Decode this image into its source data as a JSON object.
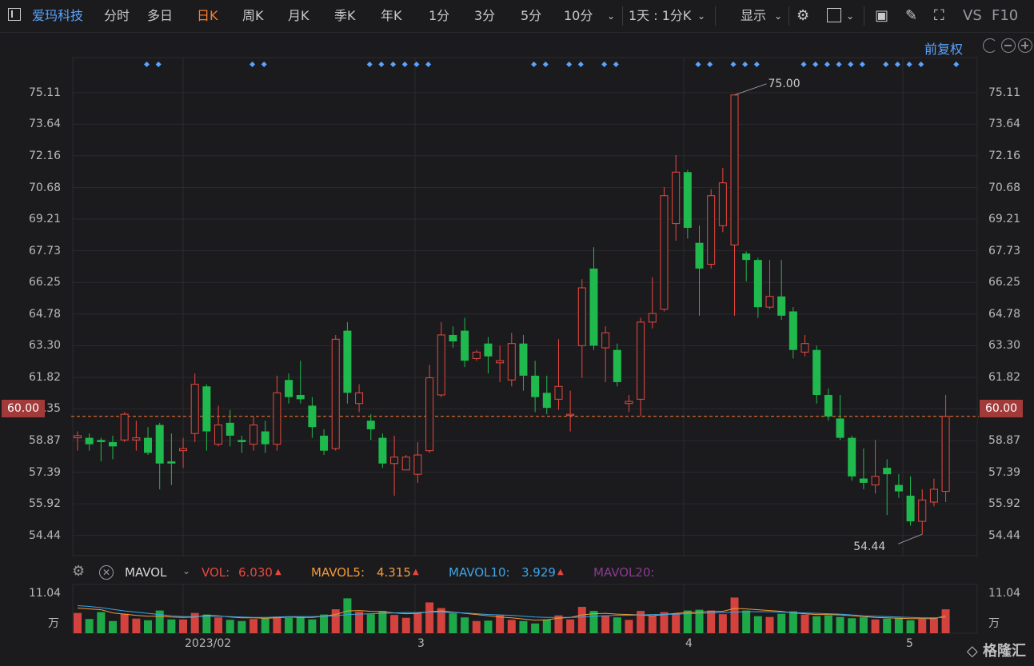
{
  "topbar": {
    "stock_name": "爱玛科技",
    "periods": [
      "分时",
      "多日",
      "日K",
      "周K",
      "月K",
      "季K",
      "年K",
      "1分",
      "3分",
      "5分",
      "10分"
    ],
    "active_period": "日K",
    "combo_label": "1天 : 1分K",
    "display_label": "显示",
    "right_labels": [
      "VS",
      "F10"
    ]
  },
  "sub": {
    "adjust_label": "前复权"
  },
  "colors": {
    "up": "#e8473f",
    "down": "#1fb94e",
    "accent": "#5aa3ff",
    "current": "#ff7a2a",
    "grid": "#2b2b30"
  },
  "chart_data": {
    "type": "candlestick",
    "y_ticks": [
      "75.11",
      "73.64",
      "72.16",
      "70.68",
      "69.21",
      "67.73",
      "66.25",
      "64.78",
      "63.30",
      "61.82",
      "60.35",
      "58.87",
      "57.39",
      "55.92",
      "54.44"
    ],
    "ylim": [
      53.5,
      76.0
    ],
    "current_price": "60.00",
    "current_value": 60.0,
    "annotations": {
      "high": "75.00",
      "low": "54.44"
    },
    "x_labels": [
      "2023/02",
      "3",
      "4",
      "5"
    ],
    "candles": [
      {
        "o": 59.0,
        "c": 59.1,
        "h": 59.3,
        "l": 58.4
      },
      {
        "o": 59.0,
        "c": 58.7,
        "h": 59.2,
        "l": 58.4
      },
      {
        "o": 58.9,
        "c": 58.8,
        "h": 59.0,
        "l": 57.9
      },
      {
        "o": 58.8,
        "c": 58.6,
        "h": 59.1,
        "l": 58.0
      },
      {
        "o": 58.9,
        "c": 60.1,
        "h": 60.2,
        "l": 58.8
      },
      {
        "o": 58.9,
        "c": 59.0,
        "h": 59.8,
        "l": 58.4
      },
      {
        "o": 59.0,
        "c": 58.3,
        "h": 59.5,
        "l": 58.2
      },
      {
        "o": 59.6,
        "c": 57.8,
        "h": 59.7,
        "l": 56.6
      },
      {
        "o": 57.9,
        "c": 57.8,
        "h": 59.2,
        "l": 56.8
      },
      {
        "o": 58.4,
        "c": 58.5,
        "h": 59.0,
        "l": 57.6
      },
      {
        "o": 59.2,
        "c": 61.5,
        "h": 62.0,
        "l": 58.8
      },
      {
        "o": 61.4,
        "c": 59.3,
        "h": 61.5,
        "l": 58.4
      },
      {
        "o": 58.7,
        "c": 59.6,
        "h": 60.5,
        "l": 58.6
      },
      {
        "o": 59.7,
        "c": 59.1,
        "h": 60.3,
        "l": 58.6
      },
      {
        "o": 58.9,
        "c": 58.8,
        "h": 59.1,
        "l": 58.3
      },
      {
        "o": 58.7,
        "c": 59.6,
        "h": 60.0,
        "l": 58.4
      },
      {
        "o": 59.3,
        "c": 58.7,
        "h": 59.8,
        "l": 58.3
      },
      {
        "o": 58.7,
        "c": 61.1,
        "h": 61.9,
        "l": 58.4
      },
      {
        "o": 61.7,
        "c": 60.9,
        "h": 62.0,
        "l": 60.6
      },
      {
        "o": 61.0,
        "c": 60.8,
        "h": 62.6,
        "l": 60.6
      },
      {
        "o": 60.5,
        "c": 59.5,
        "h": 60.9,
        "l": 59.0
      },
      {
        "o": 59.1,
        "c": 58.4,
        "h": 59.4,
        "l": 58.2
      },
      {
        "o": 58.5,
        "c": 63.6,
        "h": 63.8,
        "l": 58.4
      },
      {
        "o": 64.0,
        "c": 61.1,
        "h": 64.4,
        "l": 60.6
      },
      {
        "o": 60.6,
        "c": 61.1,
        "h": 61.5,
        "l": 60.2
      },
      {
        "o": 59.8,
        "c": 59.4,
        "h": 60.1,
        "l": 58.9
      },
      {
        "o": 59.0,
        "c": 57.8,
        "h": 59.2,
        "l": 57.6
      },
      {
        "o": 57.8,
        "c": 58.1,
        "h": 59.1,
        "l": 56.3
      },
      {
        "o": 57.5,
        "c": 58.1,
        "h": 58.2,
        "l": 57.5
      },
      {
        "o": 57.3,
        "c": 58.2,
        "h": 58.8,
        "l": 56.9
      },
      {
        "o": 58.4,
        "c": 61.8,
        "h": 62.4,
        "l": 58.3
      },
      {
        "o": 61.0,
        "c": 63.8,
        "h": 64.4,
        "l": 60.9
      },
      {
        "o": 63.8,
        "c": 63.5,
        "h": 64.2,
        "l": 63.2
      },
      {
        "o": 64.0,
        "c": 62.6,
        "h": 64.6,
        "l": 62.3
      },
      {
        "o": 62.7,
        "c": 63.0,
        "h": 63.1,
        "l": 62.6
      },
      {
        "o": 63.4,
        "c": 62.8,
        "h": 63.7,
        "l": 62.0
      },
      {
        "o": 62.5,
        "c": 62.6,
        "h": 63.3,
        "l": 61.6
      },
      {
        "o": 61.7,
        "c": 63.4,
        "h": 63.9,
        "l": 61.4
      },
      {
        "o": 63.4,
        "c": 61.9,
        "h": 63.8,
        "l": 61.2
      },
      {
        "o": 61.9,
        "c": 60.9,
        "h": 62.6,
        "l": 60.2
      },
      {
        "o": 61.1,
        "c": 60.4,
        "h": 61.9,
        "l": 60.1
      },
      {
        "o": 60.8,
        "c": 61.4,
        "h": 63.6,
        "l": 60.3
      },
      {
        "o": 60.1,
        "c": 60.1,
        "h": 61.2,
        "l": 59.3
      },
      {
        "o": 63.3,
        "c": 66.0,
        "h": 66.4,
        "l": 61.8
      },
      {
        "o": 66.9,
        "c": 63.3,
        "h": 67.9,
        "l": 63.1
      },
      {
        "o": 63.2,
        "c": 63.9,
        "h": 64.2,
        "l": 61.6
      },
      {
        "o": 63.1,
        "c": 61.6,
        "h": 63.4,
        "l": 61.4
      },
      {
        "o": 60.6,
        "c": 60.7,
        "h": 61.0,
        "l": 60.2
      },
      {
        "o": 60.8,
        "c": 64.4,
        "h": 64.6,
        "l": 60.0
      },
      {
        "o": 64.4,
        "c": 64.8,
        "h": 66.5,
        "l": 64.1
      },
      {
        "o": 65.0,
        "c": 70.3,
        "h": 70.7,
        "l": 64.9
      },
      {
        "o": 69.0,
        "c": 71.4,
        "h": 72.2,
        "l": 68.2
      },
      {
        "o": 71.4,
        "c": 68.8,
        "h": 71.5,
        "l": 68.3
      },
      {
        "o": 68.1,
        "c": 66.9,
        "h": 68.9,
        "l": 64.7
      },
      {
        "o": 67.1,
        "c": 70.3,
        "h": 70.6,
        "l": 66.9
      },
      {
        "o": 68.9,
        "c": 70.9,
        "h": 71.6,
        "l": 68.6
      },
      {
        "o": 68.0,
        "c": 75.0,
        "h": 75.0,
        "l": 64.7
      },
      {
        "o": 67.6,
        "c": 67.3,
        "h": 67.7,
        "l": 66.3
      },
      {
        "o": 67.3,
        "c": 65.1,
        "h": 67.4,
        "l": 64.6
      },
      {
        "o": 65.1,
        "c": 65.6,
        "h": 67.3,
        "l": 65.0
      },
      {
        "o": 65.6,
        "c": 64.7,
        "h": 67.3,
        "l": 64.5
      },
      {
        "o": 64.9,
        "c": 63.1,
        "h": 65.1,
        "l": 62.7
      },
      {
        "o": 63.0,
        "c": 63.4,
        "h": 63.8,
        "l": 62.8
      },
      {
        "o": 63.1,
        "c": 61.0,
        "h": 63.3,
        "l": 60.6
      },
      {
        "o": 61.0,
        "c": 60.0,
        "h": 61.3,
        "l": 59.8
      },
      {
        "o": 59.9,
        "c": 59.0,
        "h": 61.0,
        "l": 58.9
      },
      {
        "o": 59.0,
        "c": 57.2,
        "h": 59.1,
        "l": 57.0
      },
      {
        "o": 57.1,
        "c": 56.9,
        "h": 58.5,
        "l": 56.6
      },
      {
        "o": 56.8,
        "c": 57.2,
        "h": 58.9,
        "l": 56.4
      },
      {
        "o": 57.6,
        "c": 57.3,
        "h": 58.0,
        "l": 55.4
      },
      {
        "o": 56.8,
        "c": 56.5,
        "h": 57.3,
        "l": 56.2
      },
      {
        "o": 56.3,
        "c": 55.1,
        "h": 57.2,
        "l": 54.9
      },
      {
        "o": 55.1,
        "c": 56.1,
        "h": 56.6,
        "l": 54.5
      },
      {
        "o": 56.0,
        "c": 56.6,
        "h": 57.1,
        "l": 55.8
      },
      {
        "o": 56.5,
        "c": 60.0,
        "h": 61.0,
        "l": 56.0
      }
    ],
    "volume": {
      "indicator": "MAVOL",
      "ytick_top": "11.04",
      "unit": "万",
      "vol_label": "VOL:",
      "vol_value": "6.030",
      "ma5_label": "MAVOL5:",
      "ma5_value": "4.315",
      "ma10_label": "MAVOL10:",
      "ma10_value": "3.929",
      "ma20_label": "MAVOL20:",
      "values": [
        5.0,
        3.5,
        5.2,
        3.0,
        4.8,
        3.6,
        3.2,
        5.6,
        3.4,
        3.4,
        5.0,
        4.6,
        3.9,
        3.3,
        3.0,
        3.5,
        3.7,
        4.1,
        3.8,
        4.0,
        3.4,
        4.6,
        5.9,
        8.6,
        5.3,
        4.7,
        5.5,
        4.5,
        3.8,
        4.9,
        7.6,
        6.2,
        4.9,
        3.9,
        3.0,
        3.1,
        4.4,
        3.3,
        3.0,
        2.4,
        3.4,
        4.4,
        3.4,
        6.5,
        5.5,
        4.4,
        3.9,
        3.3,
        5.5,
        4.3,
        5.2,
        4.9,
        5.6,
        5.8,
        5.6,
        4.7,
        8.8,
        5.6,
        4.2,
        4.0,
        4.8,
        5.4,
        4.6,
        4.2,
        4.4,
        4.0,
        3.7,
        3.9,
        3.4,
        3.6,
        3.8,
        3.2,
        3.5,
        3.8,
        5.9
      ],
      "ma5": [
        6.2,
        6.0,
        5.8,
        5.0,
        4.7,
        4.4,
        4.2,
        4.2,
        4.0,
        3.9,
        4.0,
        4.4,
        4.3,
        4.0,
        3.8,
        3.8,
        3.7,
        3.8,
        4.0,
        3.9,
        3.9,
        4.2,
        4.6,
        5.5,
        5.6,
        5.4,
        5.3,
        5.0,
        4.8,
        4.9,
        5.3,
        5.5,
        5.2,
        4.9,
        4.6,
        4.3,
        4.0,
        3.8,
        3.5,
        3.2,
        3.3,
        3.7,
        3.9,
        4.5,
        4.8,
        4.9,
        4.7,
        4.6,
        4.5,
        4.3,
        4.6,
        4.9,
        5.1,
        5.2,
        5.4,
        5.4,
        6.1,
        6.0,
        5.8,
        5.6,
        5.4,
        5.0,
        4.8,
        4.6,
        4.6,
        4.5,
        4.3,
        4.1,
        3.9,
        3.8,
        3.7,
        3.6,
        3.6,
        3.6,
        4.3
      ],
      "ma10": [
        6.8,
        6.6,
        6.3,
        5.9,
        5.5,
        5.2,
        4.9,
        4.6,
        4.3,
        4.1,
        4.1,
        4.2,
        4.2,
        4.1,
        4.0,
        3.9,
        3.9,
        4.0,
        4.1,
        4.1,
        4.1,
        4.2,
        4.3,
        4.6,
        4.7,
        4.8,
        4.9,
        5.0,
        5.1,
        5.1,
        5.2,
        5.2,
        5.1,
        5.0,
        4.8,
        4.6,
        4.5,
        4.4,
        4.2,
        4.0,
        3.9,
        3.9,
        3.9,
        4.0,
        4.2,
        4.3,
        4.4,
        4.4,
        4.5,
        4.6,
        4.6,
        4.7,
        4.8,
        4.9,
        5.0,
        5.1,
        5.2,
        5.3,
        5.3,
        5.3,
        5.2,
        5.1,
        5.0,
        4.9,
        4.8,
        4.7,
        4.5,
        4.3,
        4.2,
        4.1,
        4.0,
        3.9,
        3.8,
        3.8,
        3.9
      ]
    }
  },
  "signal_dots": [
    3,
    4,
    12,
    13,
    22,
    23,
    24,
    25,
    26,
    27,
    36,
    37,
    39,
    40,
    42,
    43,
    50,
    51,
    53,
    54,
    55,
    59,
    60,
    61,
    62,
    63,
    64,
    66,
    67,
    68,
    69,
    72
  ]
}
